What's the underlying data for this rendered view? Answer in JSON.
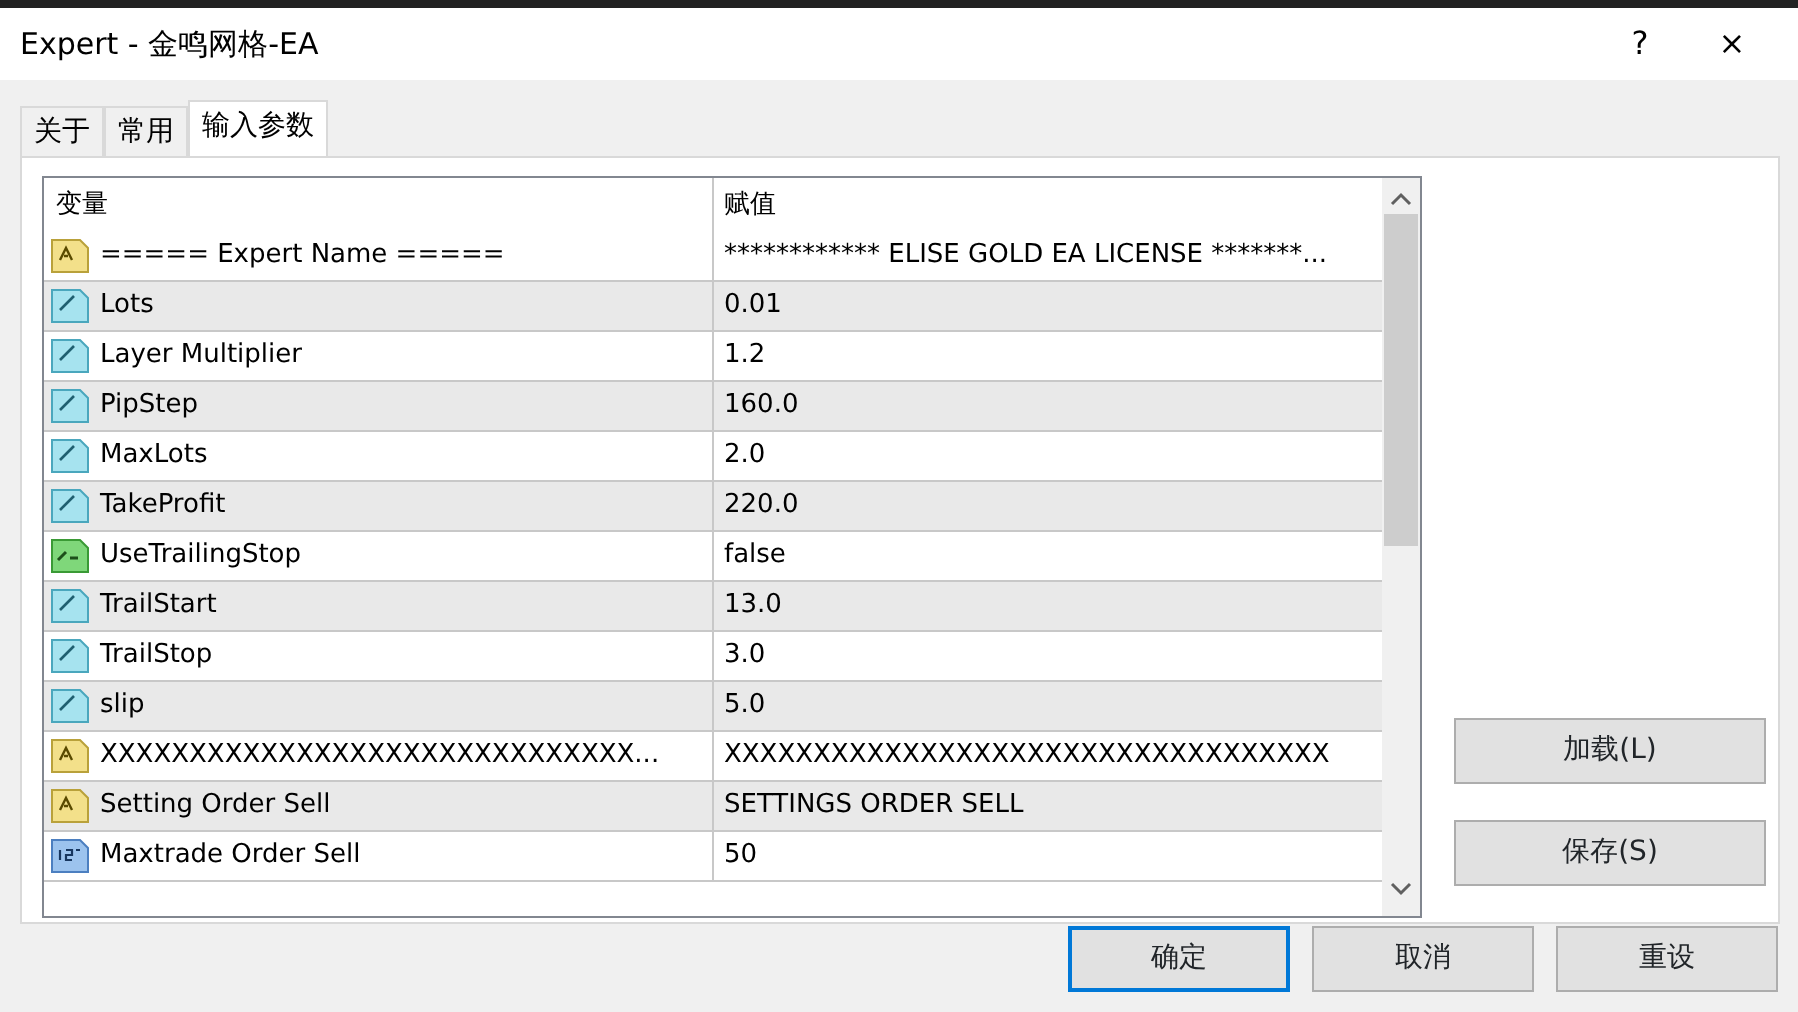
{
  "window": {
    "title": "Expert - 金鸣网格-EA",
    "help": "?",
    "close": "×"
  },
  "tabs": [
    {
      "label": "关于",
      "selected": false
    },
    {
      "label": "常用",
      "selected": false
    },
    {
      "label": "输入参数",
      "selected": true
    }
  ],
  "table": {
    "columns": [
      "变量",
      "赋值"
    ],
    "rows": [
      {
        "kind": "text",
        "name": "===== Expert Name =====",
        "value": "************ ELISE GOLD EA LICENSE *******..."
      },
      {
        "kind": "double",
        "name": "Lots",
        "value": "0.01"
      },
      {
        "kind": "double",
        "name": "Layer Multiplier",
        "value": "1.2"
      },
      {
        "kind": "double",
        "name": "PipStep",
        "value": "160.0"
      },
      {
        "kind": "double",
        "name": "MaxLots",
        "value": "2.0"
      },
      {
        "kind": "double",
        "name": "TakeProfit",
        "value": "220.0"
      },
      {
        "kind": "bool",
        "name": "UseTrailingStop",
        "value": "false"
      },
      {
        "kind": "double",
        "name": "TrailStart",
        "value": "13.0"
      },
      {
        "kind": "double",
        "name": "TrailStop",
        "value": "3.0"
      },
      {
        "kind": "double",
        "name": "slip",
        "value": "5.0"
      },
      {
        "kind": "text",
        "name": "XXXXXXXXXXXXXXXXXXXXXXXXXXXXXX...",
        "value": "XXXXXXXXXXXXXXXXXXXXXXXXXXXXXXXXXX"
      },
      {
        "kind": "text",
        "name": "Setting Order Sell",
        "value": "SETTINGS ORDER SELL"
      },
      {
        "kind": "int",
        "name": "Maxtrade Order Sell",
        "value": "50"
      }
    ]
  },
  "side_buttons": [
    "加载(L)",
    "保存(S)"
  ],
  "buttons": [
    {
      "label": "确定",
      "default": true
    },
    {
      "label": "取消",
      "default": false
    },
    {
      "label": "重设",
      "default": false
    }
  ]
}
